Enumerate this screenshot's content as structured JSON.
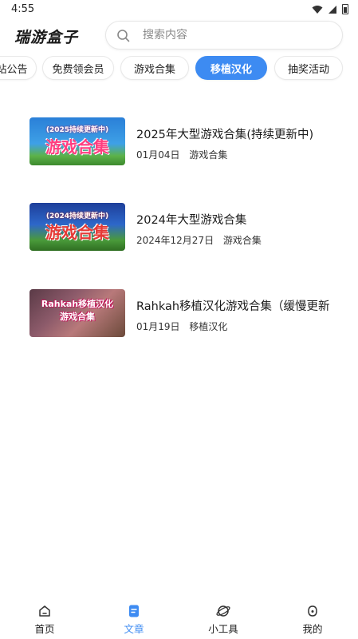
{
  "status_bar": {
    "time": "4:55"
  },
  "header": {
    "app_title": "瑞游盒子",
    "search_placeholder": "搜索内容"
  },
  "tabs": [
    {
      "label": "站公告"
    },
    {
      "label": "免费领会员"
    },
    {
      "label": "游戏合集"
    },
    {
      "label": "移植汉化",
      "active": true
    },
    {
      "label": "抽奖活动"
    }
  ],
  "articles": [
    {
      "title": "2025年大型游戏合集(持续更新中)",
      "date": "01月04日",
      "category": "游戏合集",
      "thumb_line1": "(2025持续更新中)",
      "thumb_line2": "游戏合集"
    },
    {
      "title": "2024年大型游戏合集",
      "date": "2024年12月27日",
      "category": "游戏合集",
      "thumb_line1": "(2024持续更新中)",
      "thumb_line2": "游戏合集"
    },
    {
      "title": "Rahkah移植汉化游戏合集（缓慢更新",
      "date": "01月19日",
      "category": "移植汉化",
      "thumb_line1": "Rahkah移植汉化",
      "thumb_line2": "游戏合集"
    }
  ],
  "bottom_nav": [
    {
      "label": "首页",
      "icon": "home-icon"
    },
    {
      "label": "文章",
      "icon": "article-icon",
      "active": true
    },
    {
      "label": "小工具",
      "icon": "tools-icon"
    },
    {
      "label": "我的",
      "icon": "profile-icon"
    }
  ],
  "colors": {
    "accent": "#3d8bf2"
  }
}
